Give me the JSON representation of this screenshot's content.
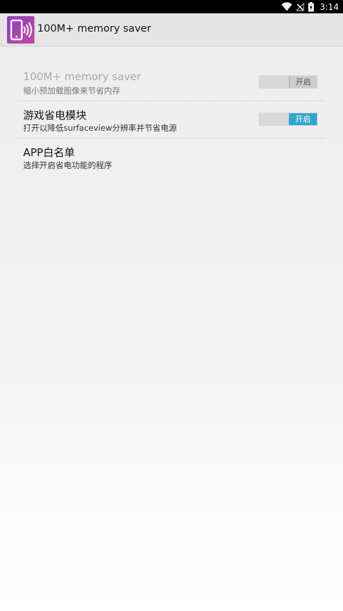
{
  "status_bar": {
    "time": "3:14",
    "icons": [
      "wifi-icon",
      "no-signal-icon",
      "battery-charging-icon"
    ]
  },
  "action_bar": {
    "title": "100M+ memory saver",
    "icon": "phone-signal-app-icon"
  },
  "preferences": [
    {
      "title": "100M+ memory saver",
      "summary": "缩小预加载图像来节省内存",
      "toggle_label": "开启",
      "enabled": false,
      "checked": false
    },
    {
      "title": "游戏省电模块",
      "summary": "打开以降低surfaceview分辨率并节省电源",
      "toggle_label": "开启",
      "enabled": true,
      "checked": true
    },
    {
      "title": "APP白名单",
      "summary": "选择开启省电功能的程序"
    }
  ],
  "colors": {
    "accent": "#33a6cf",
    "action_bar": "#e6e6e6",
    "status_bar": "#000000"
  }
}
